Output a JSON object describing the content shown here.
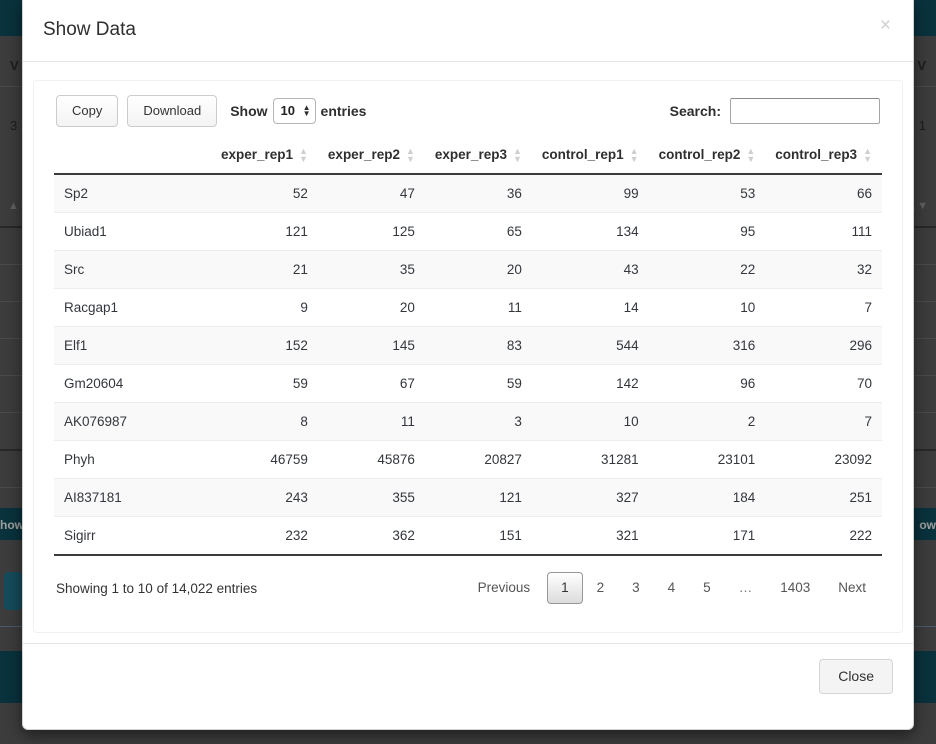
{
  "modal": {
    "title": "Show Data",
    "close_icon": "times-icon",
    "close_button_label": "Close"
  },
  "toolbar": {
    "copy_label": "Copy",
    "download_label": "Download",
    "show_label": "Show",
    "entries_label": "entries",
    "page_length_value": "10",
    "search_label": "Search:",
    "search_value": "",
    "search_placeholder": ""
  },
  "table": {
    "columns": [
      {
        "label": "",
        "key": "gene",
        "sortable": true
      },
      {
        "label": "exper_rep1",
        "key": "exper_rep1",
        "sortable": true
      },
      {
        "label": "exper_rep2",
        "key": "exper_rep2",
        "sortable": true
      },
      {
        "label": "exper_rep3",
        "key": "exper_rep3",
        "sortable": true
      },
      {
        "label": "control_rep1",
        "key": "control_rep1",
        "sortable": true
      },
      {
        "label": "control_rep2",
        "key": "control_rep2",
        "sortable": true
      },
      {
        "label": "control_rep3",
        "key": "control_rep3",
        "sortable": true
      }
    ],
    "rows": [
      {
        "gene": "Sp2",
        "exper_rep1": "52",
        "exper_rep2": "47",
        "exper_rep3": "36",
        "control_rep1": "99",
        "control_rep2": "53",
        "control_rep3": "66"
      },
      {
        "gene": "Ubiad1",
        "exper_rep1": "121",
        "exper_rep2": "125",
        "exper_rep3": "65",
        "control_rep1": "134",
        "control_rep2": "95",
        "control_rep3": "111"
      },
      {
        "gene": "Src",
        "exper_rep1": "21",
        "exper_rep2": "35",
        "exper_rep3": "20",
        "control_rep1": "43",
        "control_rep2": "22",
        "control_rep3": "32"
      },
      {
        "gene": "Racgap1",
        "exper_rep1": "9",
        "exper_rep2": "20",
        "exper_rep3": "11",
        "control_rep1": "14",
        "control_rep2": "10",
        "control_rep3": "7"
      },
      {
        "gene": "Elf1",
        "exper_rep1": "152",
        "exper_rep2": "145",
        "exper_rep3": "83",
        "control_rep1": "544",
        "control_rep2": "316",
        "control_rep3": "296"
      },
      {
        "gene": "Gm20604",
        "exper_rep1": "59",
        "exper_rep2": "67",
        "exper_rep3": "59",
        "control_rep1": "142",
        "control_rep2": "96",
        "control_rep3": "70"
      },
      {
        "gene": "AK076987",
        "exper_rep1": "8",
        "exper_rep2": "11",
        "exper_rep3": "3",
        "control_rep1": "10",
        "control_rep2": "2",
        "control_rep3": "7"
      },
      {
        "gene": "Phyh",
        "exper_rep1": "46759",
        "exper_rep2": "45876",
        "exper_rep3": "20827",
        "control_rep1": "31281",
        "control_rep2": "23101",
        "control_rep3": "23092"
      },
      {
        "gene": "AI837181",
        "exper_rep1": "243",
        "exper_rep2": "355",
        "exper_rep3": "121",
        "control_rep1": "327",
        "control_rep2": "184",
        "control_rep3": "251"
      },
      {
        "gene": "Sigirr",
        "exper_rep1": "232",
        "exper_rep2": "362",
        "exper_rep3": "151",
        "control_rep1": "321",
        "control_rep2": "171",
        "control_rep3": "222"
      }
    ]
  },
  "footer": {
    "info": "Showing 1 to 10 of 14,022 entries",
    "pagination": {
      "previous_label": "Previous",
      "next_label": "Next",
      "pages": [
        "1",
        "2",
        "3",
        "4",
        "5",
        "…",
        "1403"
      ],
      "current_page": "1"
    }
  },
  "background": {
    "label_v": "V",
    "label_3": "3",
    "label_1": "1",
    "label_show_left": "how",
    "label_show_right": "ow"
  },
  "colors": {
    "brand_teal": "#0e4b5a",
    "overlay": "rgba(0,0,0,0.32)",
    "row_stripe": "#f9f9f9",
    "border_dark": "#3b3b3b"
  }
}
